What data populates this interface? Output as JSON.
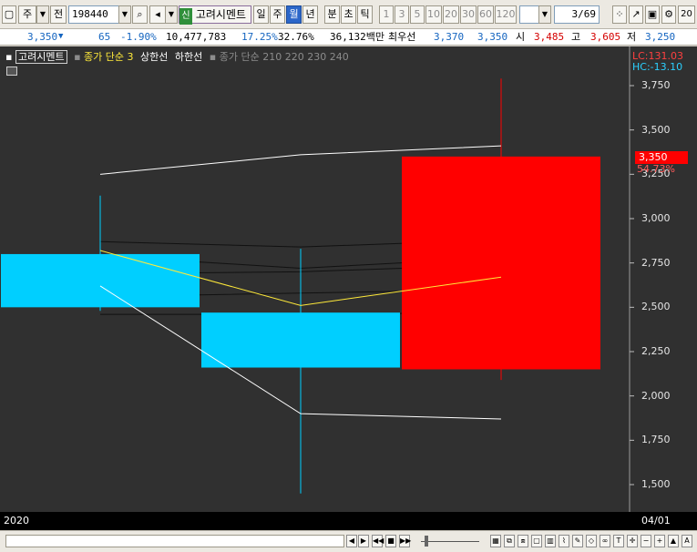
{
  "toolbar": {
    "market": "주",
    "mode": "전",
    "code": "198440",
    "name_tag": "신",
    "name": "고려시멘트",
    "periods": [
      "일",
      "주",
      "월",
      "년",
      "분",
      "초",
      "틱"
    ],
    "selected_period": "월",
    "intervals": [
      "1",
      "3",
      "5",
      "10",
      "20",
      "30",
      "60",
      "120"
    ],
    "page": "3/69",
    "edge_label": "20"
  },
  "quote": {
    "price": "3,350",
    "change": "65",
    "change_pct": "-1.90%",
    "volume": "10,477,783",
    "turnover_pct": "17.25%",
    "ratio_pct": "32.76%",
    "amount": "36,132백만",
    "best_label": "최우선",
    "ask": "3,370",
    "bid": "3,350",
    "open_label": "시",
    "open": "3,485",
    "high_label": "고",
    "high": "3,605",
    "low_label": "저",
    "low": "3,250"
  },
  "legend": {
    "stock": "고려시멘트",
    "ma": "종가 단순 3",
    "upper": "상한선",
    "lower": "하한선",
    "ma2": "종가 단순",
    "ma2_periods": "210  220  230  240"
  },
  "chart_data": {
    "type": "candlestick",
    "lc_label": "LC:131.03",
    "hc_label": "HC:-13.10",
    "price_tag": "3,350",
    "pct_tag": "54.73%",
    "x_start_label": "2020",
    "x_end_label": "04/01",
    "ylim": [
      1400,
      3850
    ],
    "yticks": [
      "3,750",
      "3,500",
      "3,250",
      "3,000",
      "2,750",
      "2,500",
      "2,250",
      "2,000",
      "1,750",
      "1,500"
    ],
    "ytick_values": [
      3750,
      3500,
      3250,
      3000,
      2750,
      2500,
      2250,
      2000,
      1750,
      1500
    ],
    "candles": [
      {
        "open": 2800,
        "close": 2500,
        "high": 3130,
        "low": 2480,
        "color": "#00cfff"
      },
      {
        "open": 2470,
        "close": 2160,
        "high": 2830,
        "low": 1450,
        "color": "#00cfff"
      },
      {
        "open": 2150,
        "close": 3350,
        "high": 3790,
        "low": 2090,
        "color": "#ff0000"
      }
    ],
    "ma3": [
      2820,
      2510,
      2670
    ],
    "upper_band": [
      3250,
      3360,
      3410
    ],
    "lower_band": [
      2620,
      1900,
      1870
    ],
    "ma_color": "#ffea3a",
    "band_color": "#ffffff",
    "ma_long": [
      [
        2870,
        2840,
        2880
      ],
      [
        2790,
        2720,
        2780
      ],
      [
        2690,
        2700,
        2740
      ],
      [
        2560,
        2580,
        2600
      ],
      [
        2460,
        2460,
        2470
      ]
    ]
  }
}
